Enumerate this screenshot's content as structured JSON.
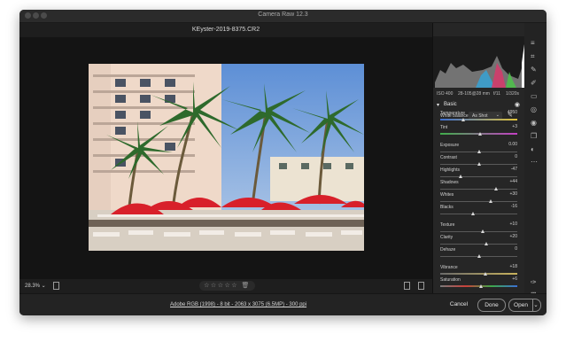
{
  "window": {
    "title": "Camera Raw 12.3"
  },
  "file": {
    "name": "KEyster-2019-8375.CR2"
  },
  "exif": {
    "iso": "ISO 400",
    "lens": "28-105@28 mm",
    "aperture": "f/11",
    "shutter": "1/320s"
  },
  "panel": {
    "section": "Basic",
    "white_balance_label": "White balance",
    "white_balance_value": "As Shot",
    "sliders": [
      {
        "label": "Temperature",
        "value": "4950",
        "level": 0.3,
        "grad": "linear-gradient(90deg,#3d6fd1,#e0c23a)"
      },
      {
        "label": "Tint",
        "value": "+3",
        "level": 0.52,
        "grad": "linear-gradient(90deg,#3fae4a,#c43fc4)"
      },
      {
        "label": "Exposure",
        "value": "0.00",
        "level": 0.5
      },
      {
        "label": "Contrast",
        "value": "0",
        "level": 0.5
      },
      {
        "label": "Highlights",
        "value": "-47",
        "level": 0.26
      },
      {
        "label": "Shadows",
        "value": "+44",
        "level": 0.72
      },
      {
        "label": "Whites",
        "value": "+30",
        "level": 0.65
      },
      {
        "label": "Blacks",
        "value": "-16",
        "level": 0.42
      },
      {
        "label": "Texture",
        "value": "+10",
        "level": 0.55
      },
      {
        "label": "Clarity",
        "value": "+20",
        "level": 0.6
      },
      {
        "label": "Dehaze",
        "value": "0",
        "level": 0.5
      },
      {
        "label": "Vibrance",
        "value": "+18",
        "level": 0.59,
        "grad": "linear-gradient(90deg,#6b6b6b,#c8b25c)"
      },
      {
        "label": "Saturation",
        "value": "+6",
        "level": 0.53,
        "grad": "linear-gradient(90deg,#7a7a7a,#c9403a,#3ea84a,#3b6fd6)"
      }
    ]
  },
  "status": {
    "zoom": "28.3%"
  },
  "bottom": {
    "workflow": "Adobe RGB (1998) - 8 bit - 2063 x 3075 (6.5MP) - 300 ppi",
    "cancel": "Cancel",
    "done": "Done",
    "open": "Open"
  }
}
